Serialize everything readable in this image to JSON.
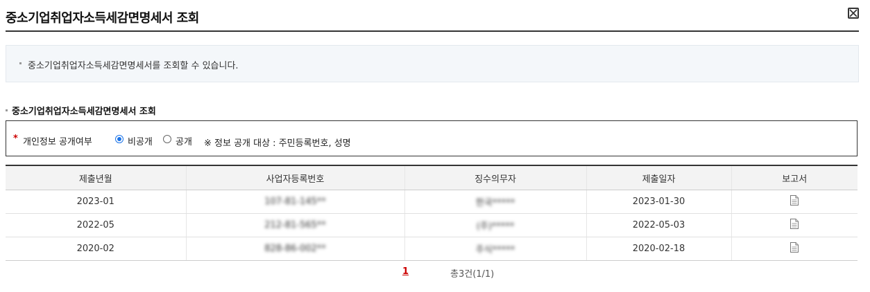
{
  "header": {
    "title": "중소기업취업자소득세감면명세서 조회",
    "close_icon": "close-box-icon"
  },
  "info": {
    "text": "중소기업취업자소득세감면명세서를 조회할 수 있습니다."
  },
  "section": {
    "title": "중소기업취업자소득세감면명세서 조회"
  },
  "privacy": {
    "required_mark": "*",
    "label": "개인정보 공개여부",
    "options": [
      {
        "label": "비공개",
        "selected": true
      },
      {
        "label": "공개",
        "selected": false
      }
    ],
    "note": "※ 정보 공개 대상 : 주민등록번호, 성명"
  },
  "table": {
    "columns": [
      "제출년월",
      "사업자등록번호",
      "징수의무자",
      "제출일자",
      "보고서"
    ],
    "rows": [
      {
        "month": "2023-01",
        "reg_no": "107-81-145**",
        "payer": "한국*****",
        "date": "2023-01-30",
        "report_icon": "document-icon"
      },
      {
        "month": "2022-05",
        "reg_no": "212-81-565**",
        "payer": "(주)*****",
        "date": "2022-05-03",
        "report_icon": "document-icon"
      },
      {
        "month": "2020-02",
        "reg_no": "828-86-002**",
        "payer": "주식*****",
        "date": "2020-02-18",
        "report_icon": "document-icon"
      }
    ]
  },
  "pagination": {
    "current_page": "1",
    "summary": "총3건(1/1)"
  }
}
